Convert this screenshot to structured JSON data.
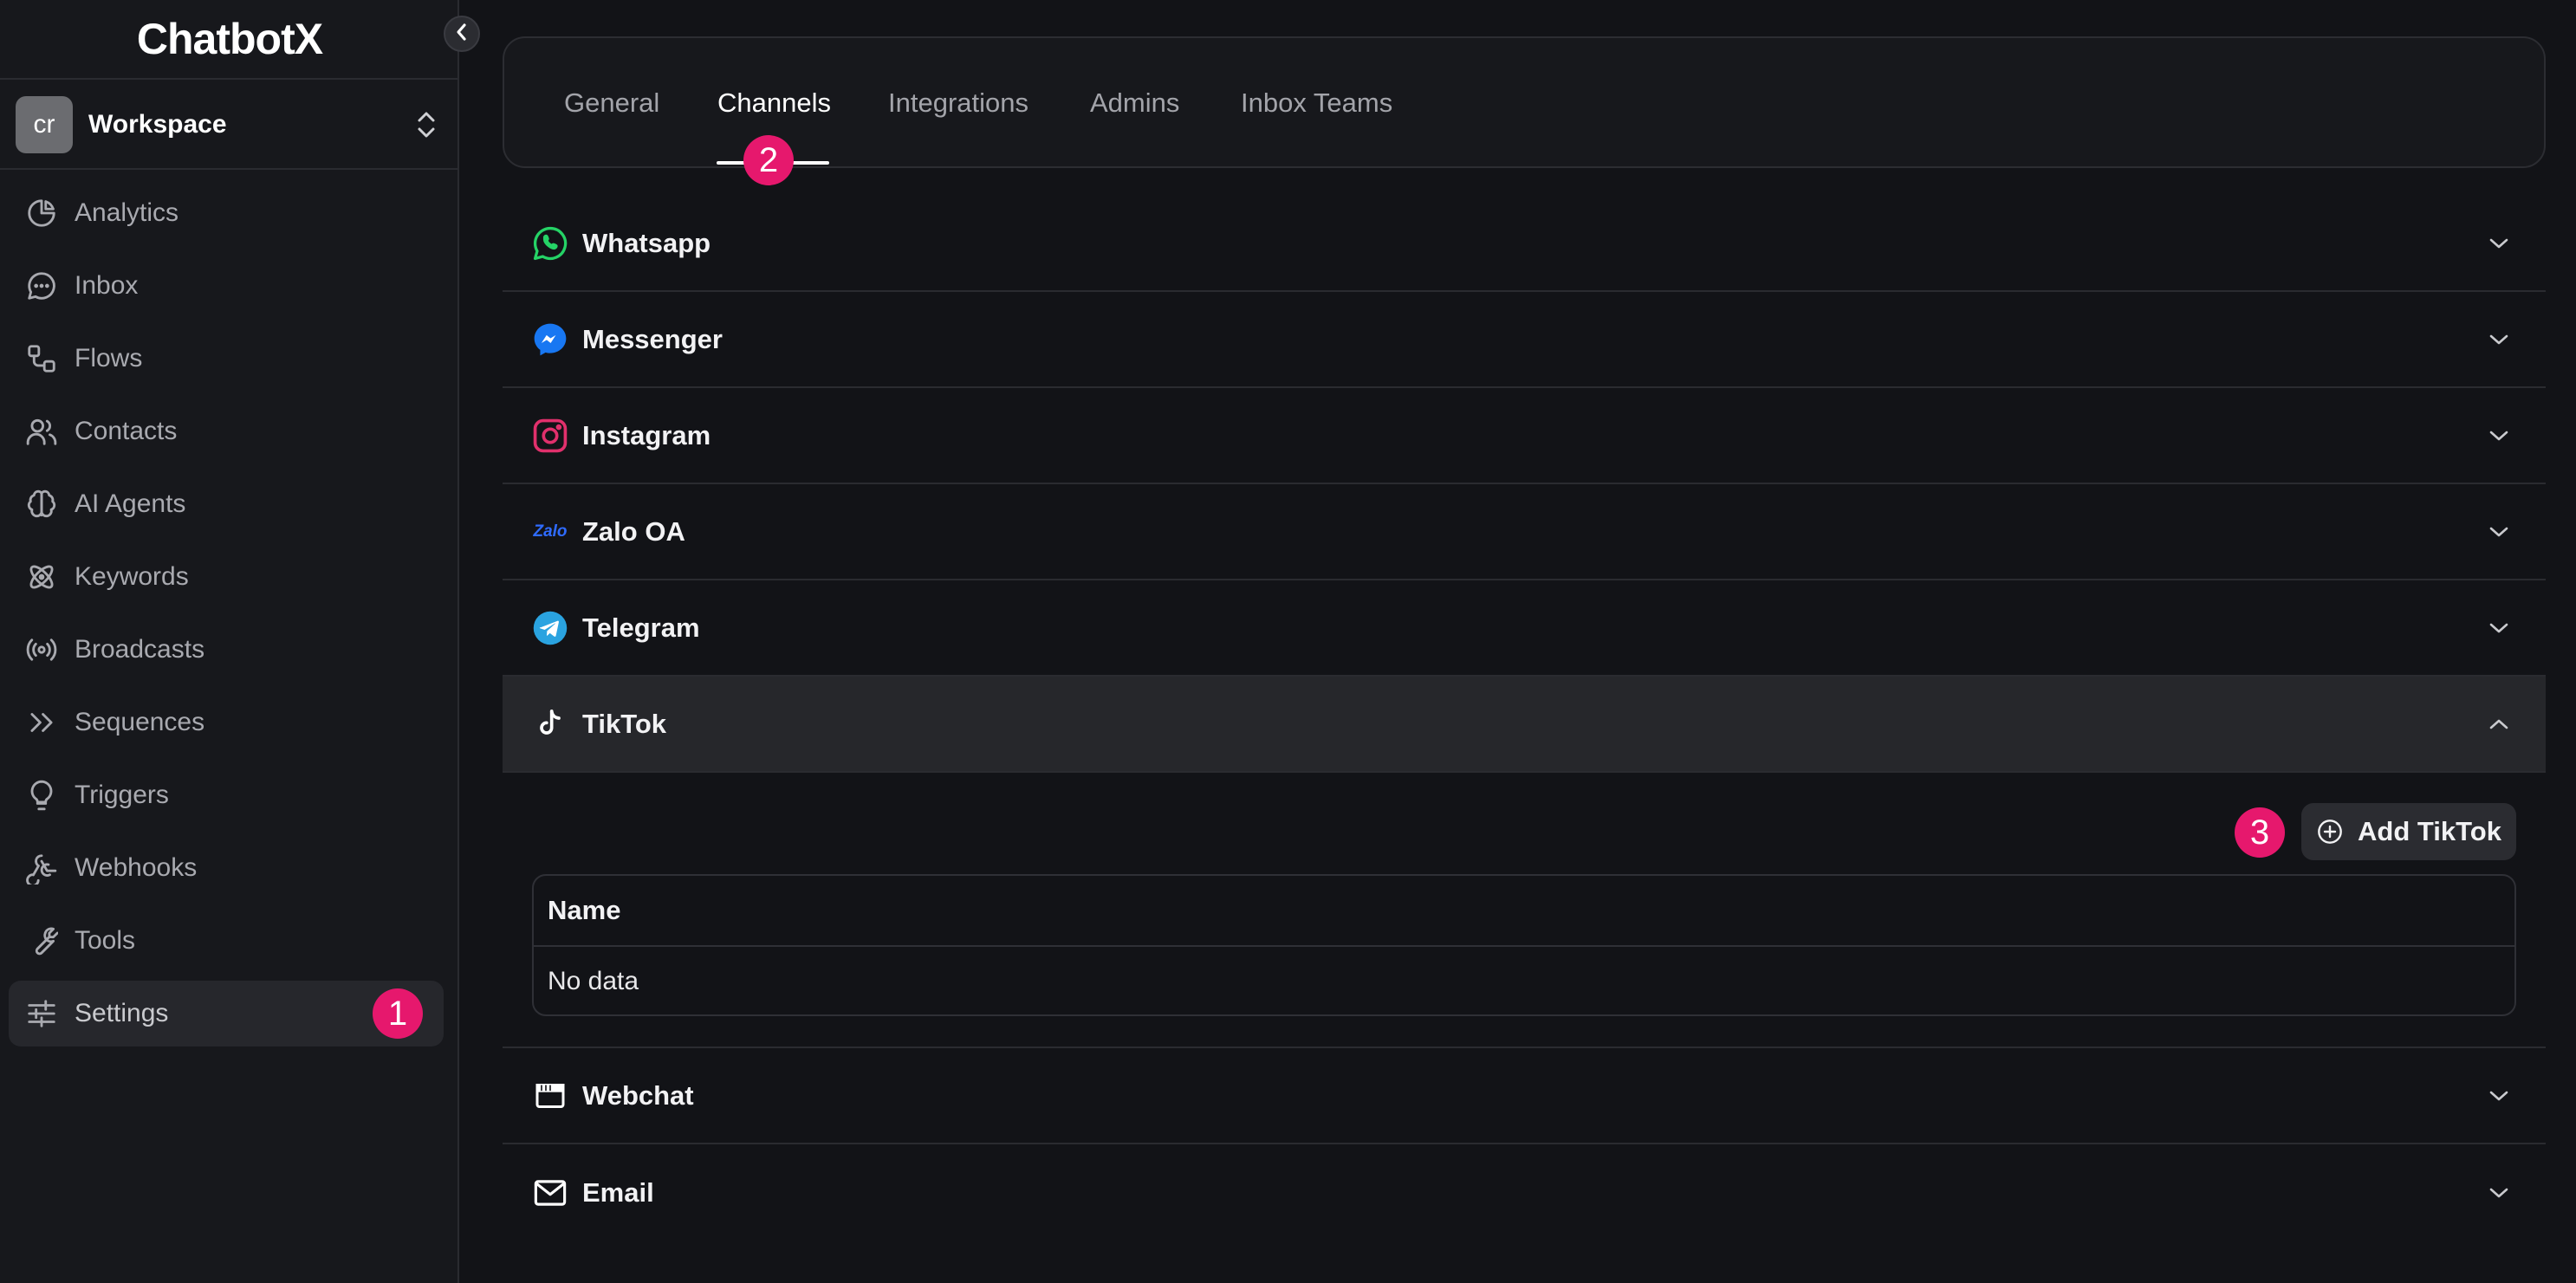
{
  "app": {
    "logo": "ChatbotX"
  },
  "workspace": {
    "avatar_initials": "cr",
    "name": "Workspace"
  },
  "sidebar": {
    "items": [
      {
        "label": "Analytics",
        "icon": "pie-chart-icon"
      },
      {
        "label": "Inbox",
        "icon": "chat-bubble-icon"
      },
      {
        "label": "Flows",
        "icon": "flow-icon"
      },
      {
        "label": "Contacts",
        "icon": "users-icon"
      },
      {
        "label": "AI Agents",
        "icon": "brain-icon"
      },
      {
        "label": "Keywords",
        "icon": "atom-icon"
      },
      {
        "label": "Broadcasts",
        "icon": "broadcast-icon"
      },
      {
        "label": "Sequences",
        "icon": "double-chevron-icon"
      },
      {
        "label": "Triggers",
        "icon": "lightbulb-icon"
      },
      {
        "label": "Webhooks",
        "icon": "webhook-icon"
      },
      {
        "label": "Tools",
        "icon": "wrench-icon"
      },
      {
        "label": "Settings",
        "icon": "sliders-icon",
        "active": true
      }
    ]
  },
  "markers": {
    "one": "1",
    "two": "2",
    "three": "3"
  },
  "tabs": [
    {
      "label": "General"
    },
    {
      "label": "Channels",
      "active": true
    },
    {
      "label": "Integrations"
    },
    {
      "label": "Admins"
    },
    {
      "label": "Inbox Teams"
    }
  ],
  "channels": [
    {
      "label": "Whatsapp",
      "icon": "whatsapp-icon"
    },
    {
      "label": "Messenger",
      "icon": "messenger-icon"
    },
    {
      "label": "Instagram",
      "icon": "instagram-icon"
    },
    {
      "label": "Zalo OA",
      "icon": "zalo-icon",
      "icon_text": "Zalo"
    },
    {
      "label": "Telegram",
      "icon": "telegram-icon"
    },
    {
      "label": "TikTok",
      "icon": "tiktok-icon",
      "expanded": true
    },
    {
      "label": "Webchat",
      "icon": "webchat-icon"
    },
    {
      "label": "Email",
      "icon": "mail-icon"
    }
  ],
  "tiktok_panel": {
    "add_label": "Add TikTok",
    "table": {
      "header": "Name",
      "empty": "No data"
    }
  },
  "colors": {
    "background": "#121317",
    "sidebar": "#17181c",
    "marker": "#e6186d",
    "whatsapp": "#25d366",
    "messenger": "#1877f2",
    "instagram": "#e1306c",
    "telegram": "#2aa3e0",
    "zalo": "#2f6bff"
  }
}
